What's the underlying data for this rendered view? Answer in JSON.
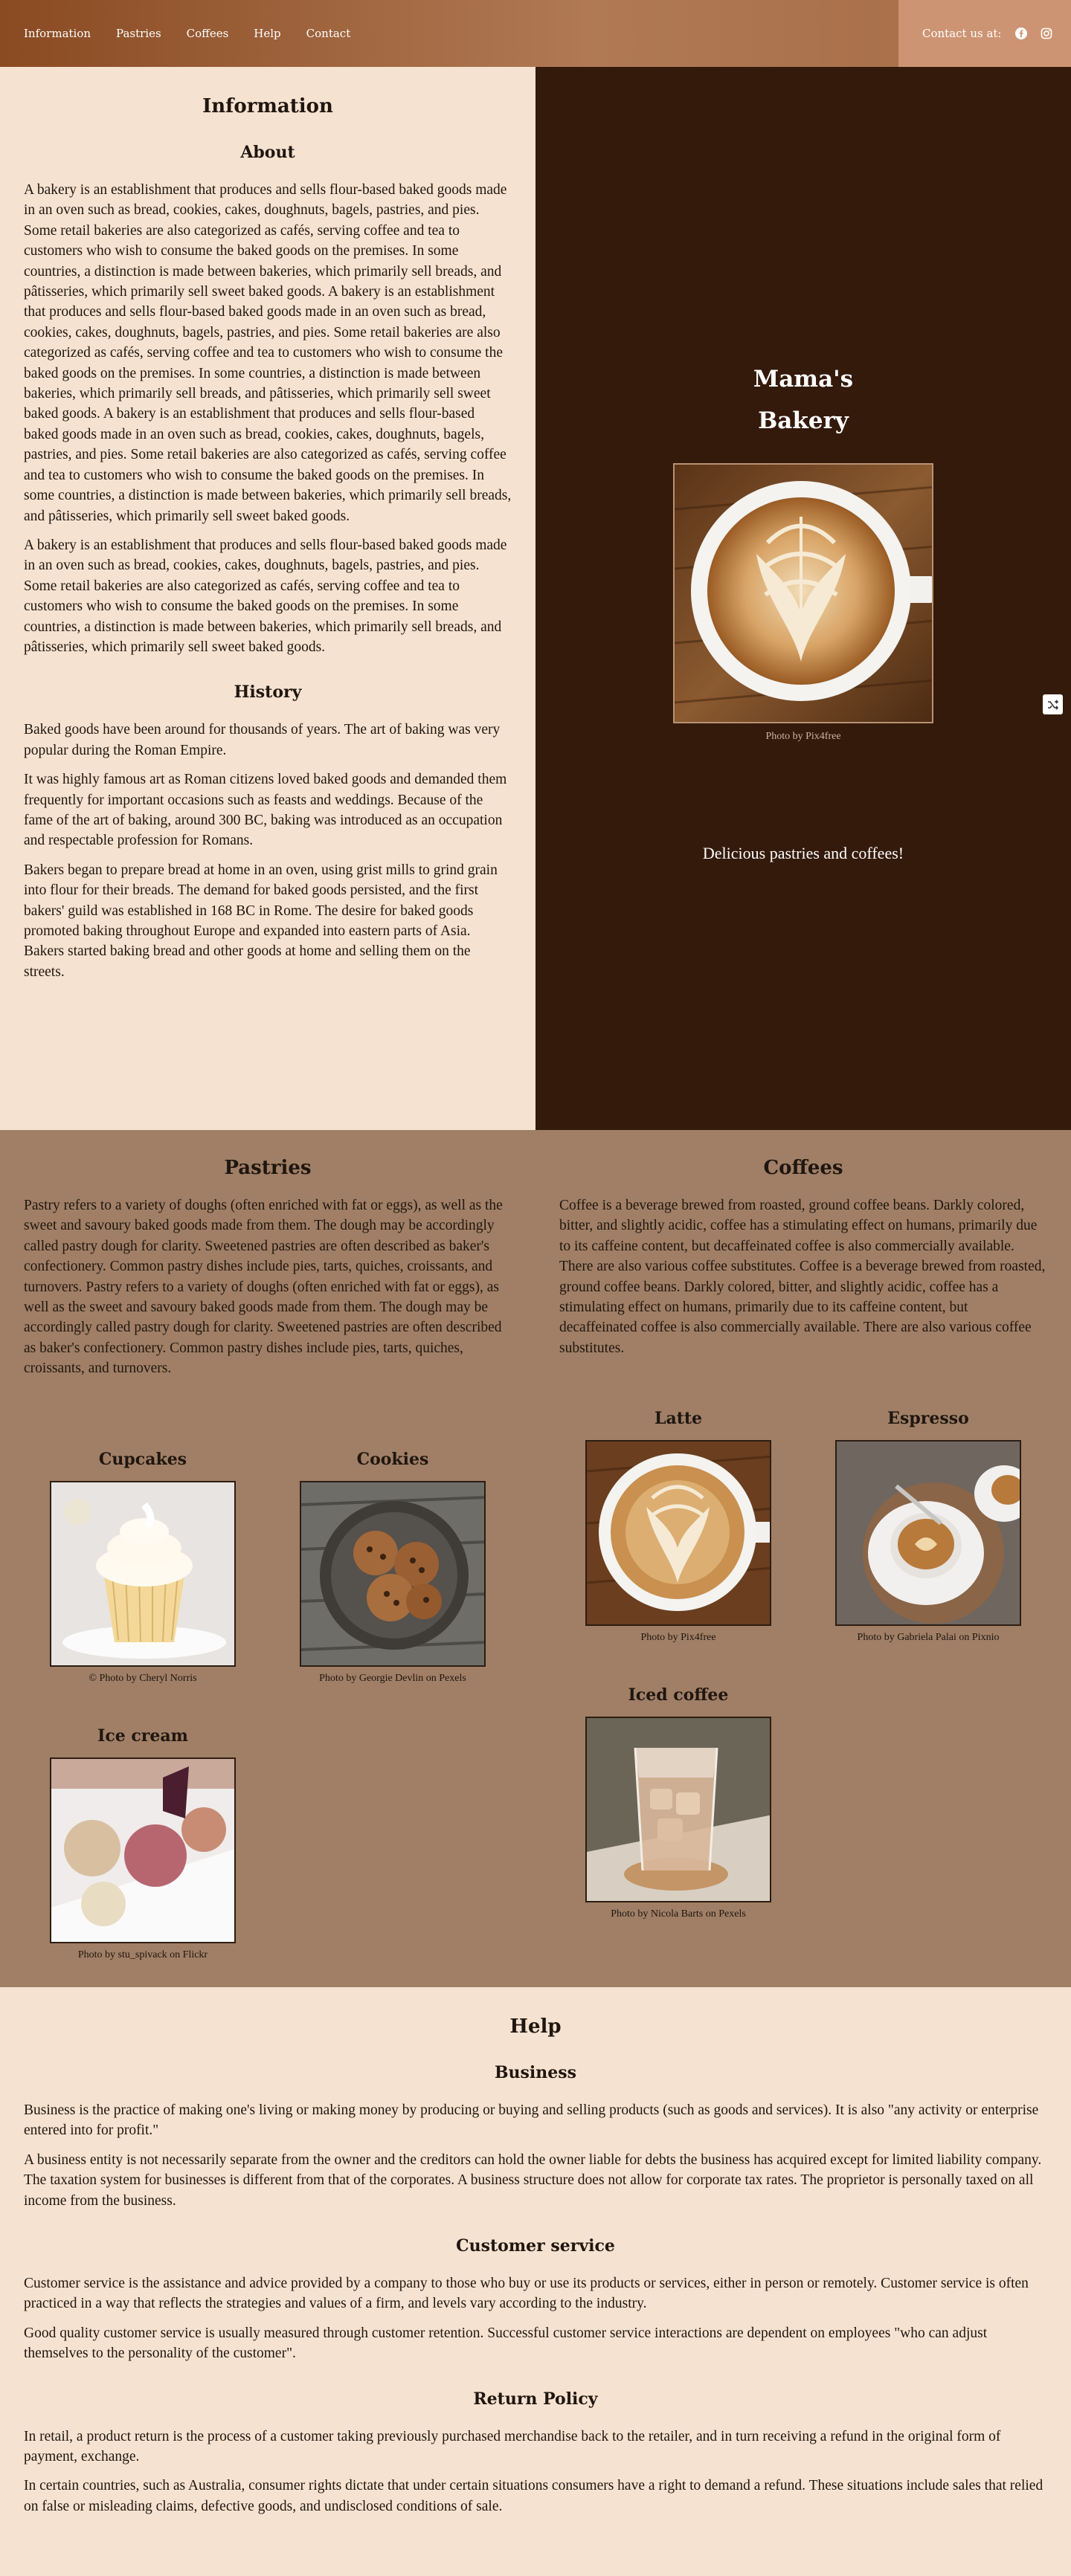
{
  "nav": {
    "links": [
      "Information",
      "Pastries",
      "Coffees",
      "Help",
      "Contact"
    ],
    "contact_label": "Contact us at:",
    "social": [
      "facebook-icon",
      "instagram-icon"
    ],
    "colors": {
      "bar": "#8a4a22",
      "contact_bg": "#cd9473"
    }
  },
  "info": {
    "title": "Information",
    "about": {
      "heading": "About",
      "p1": "A bakery is an establishment that produces and sells flour-based baked goods made in an oven such as bread, cookies, cakes, doughnuts, bagels, pastries, and pies. Some retail bakeries are also categorized as cafés, serving coffee and tea to customers who wish to consume the baked goods on the premises. In some countries, a distinction is made between bakeries, which primarily sell breads, and pâtisseries, which primarily sell sweet baked goods. A bakery is an establishment that produces and sells flour-based baked goods made in an oven such as bread, cookies, cakes, doughnuts, bagels, pastries, and pies. Some retail bakeries are also categorized as cafés, serving coffee and tea to customers who wish to consume the baked goods on the premises. In some countries, a distinction is made between bakeries, which primarily sell breads, and pâtisseries, which primarily sell sweet baked goods. A bakery is an establishment that produces and sells flour-based baked goods made in an oven such as bread, cookies, cakes, doughnuts, bagels, pastries, and pies. Some retail bakeries are also categorized as cafés, serving coffee and tea to customers who wish to consume the baked goods on the premises. In some countries, a distinction is made between bakeries, which primarily sell breads, and pâtisseries, which primarily sell sweet baked goods.",
      "p2": "A bakery is an establishment that produces and sells flour-based baked goods made in an oven such as bread, cookies, cakes, doughnuts, bagels, pastries, and pies. Some retail bakeries are also categorized as cafés, serving coffee and tea to customers who wish to consume the baked goods on the premises. In some countries, a distinction is made between bakeries, which primarily sell breads, and pâtisseries, which primarily sell sweet baked goods."
    },
    "history": {
      "heading": "History",
      "p1": "Baked goods have been around for thousands of years. The art of baking was very popular during the Roman Empire.",
      "p2": "It was highly famous art as Roman citizens loved baked goods and demanded them frequently for important occasions such as feasts and weddings. Because of the fame of the art of baking, around 300 BC, baking was introduced as an occupation and respectable profession for Romans.",
      "p3": "Bakers began to prepare bread at home in an oven, using grist mills to grind grain into flour for their breads. The demand for baked goods persisted, and the first bakers' guild was established in 168 BC in Rome. The desire for baked goods promoted baking throughout Europe and expanded into eastern parts of Asia. Bakers started baking bread and other goods at home and selling them on the streets."
    }
  },
  "banner": {
    "line1": "Mama's",
    "line2": "Bakery",
    "photo_caption": "Photo by Pix4free",
    "tagline": "Delicious pastries and coffees!",
    "bg": "#341a0b"
  },
  "pastries": {
    "heading": "Pastries",
    "text": "Pastry refers to a variety of doughs (often enriched with fat or eggs), as well as the sweet and savoury baked goods made from them. The dough may be accordingly called pastry dough for clarity. Sweetened pastries are often described as baker's confectionery. Common pastry dishes include pies, tarts, quiches, croissants, and turnovers. Pastry refers to a variety of doughs (often enriched with fat or eggs), as well as the sweet and savoury baked goods made from them. The dough may be accordingly called pastry dough for clarity. Sweetened pastries are often described as baker's confectionery. Common pastry dishes include pies, tarts, quiches, croissants, and turnovers.",
    "items": [
      {
        "title": "Cupcakes",
        "caption": "Photo by Cheryl Norris",
        "caption_icon": "copyright-icon"
      },
      {
        "title": "Cookies",
        "caption": "Photo by Georgie Devlin on Pexels"
      },
      {
        "title": "Ice cream",
        "caption": "Photo by stu_spivack on Flickr"
      }
    ]
  },
  "coffees": {
    "heading": "Coffees",
    "text": "Coffee is a beverage brewed from roasted, ground coffee beans. Darkly colored, bitter, and slightly acidic, coffee has a stimulating effect on humans, primarily due to its caffeine content, but decaffeinated coffee is also commercially available. There are also various coffee substitutes. Coffee is a beverage brewed from roasted, ground coffee beans. Darkly colored, bitter, and slightly acidic, coffee has a stimulating effect on humans, primarily due to its caffeine content, but decaffeinated coffee is also commercially available. There are also various coffee substitutes.",
    "items": [
      {
        "title": "Latte",
        "caption": "Photo by Pix4free"
      },
      {
        "title": "Espresso",
        "caption": "Photo by Gabriela Palai on Pixnio"
      },
      {
        "title": "Iced coffee",
        "caption": "Photo by Nicola Barts on Pexels"
      }
    ]
  },
  "help": {
    "title": "Help",
    "business": {
      "heading": "Business",
      "p1": "Business is the practice of making one's living or making money by producing or buying and selling products (such as goods and services). It is also \"any activity or enterprise entered into for profit.\"",
      "p2": "A business entity is not necessarily separate from the owner and the creditors can hold the owner liable for debts the business has acquired except for limited liability company. The taxation system for businesses is different from that of the corporates. A business structure does not allow for corporate tax rates. The proprietor is personally taxed on all income from the business."
    },
    "customer_service": {
      "heading": "Customer service",
      "p1": "Customer service is the assistance and advice provided by a company to those who buy or use its products or services, either in person or remotely. Customer service is often practiced in a way that reflects the strategies and values of a firm, and levels vary according to the industry.",
      "p2": "Good quality customer service is usually measured through customer retention. Successful customer service interactions are dependent on employees \"who can adjust themselves to the personality of the customer\"."
    },
    "return_policy": {
      "heading": "Return Policy",
      "p1": "In retail, a product return is the process of a customer taking previously purchased merchandise back to the retailer, and in turn receiving a refund in the original form of payment, exchange.",
      "p2": "In certain countries, such as Australia, consumer rights dictate that under certain situations consumers have a right to demand a refund. These situations include sales that relied on false or misleading claims, defective goods, and undisclosed conditions of sale."
    }
  }
}
